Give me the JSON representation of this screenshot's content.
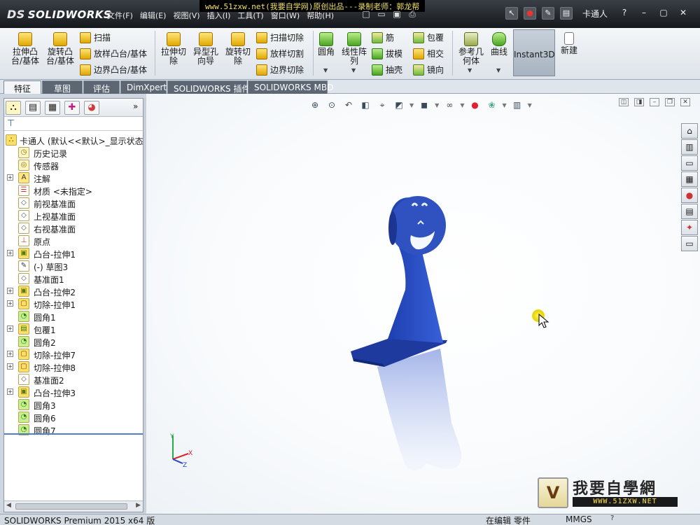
{
  "titlebar": {
    "logo": "SOLIDWORKS",
    "logo_mark": "DS",
    "menus": [
      "文件(F)",
      "编辑(E)",
      "视图(V)",
      "插入(I)",
      "工具(T)",
      "窗口(W)",
      "帮助(H)"
    ],
    "banner": "www.51zxw.net(我要自学网)原创出品---录制老师：郭龙帮",
    "document_title": "卡通人",
    "help": "?"
  },
  "ribbon": {
    "extrude_boss": "拉伸凸\n台/基体",
    "revolve_boss": "旋转凸\n台/基体",
    "sweep": "扫描",
    "loft_boss": "放样凸台/基体",
    "boundary_boss": "边界凸台/基体",
    "extrude_cut": "拉伸切\n除",
    "hole_wizard": "异型孔\n向导",
    "revolve_cut": "旋转切\n除",
    "sweep_cut": "扫描切除",
    "loft_cut": "放样切割",
    "boundary_cut": "边界切除",
    "fillet": "圆角",
    "linear_pattern": "线性阵\n列",
    "rib": "筋",
    "draft": "拔模",
    "shell": "抽壳",
    "wrap": "包覆",
    "intersect": "相交",
    "mirror": "镜向",
    "ref_geometry": "参考几\n何体",
    "curves": "曲线",
    "instant3d": "Instant3D",
    "new": "新建"
  },
  "tabs": [
    {
      "label": "特征",
      "active": true
    },
    {
      "label": "草图",
      "active": false
    },
    {
      "label": "评估",
      "active": false
    },
    {
      "label": "DimXpert",
      "active": false
    },
    {
      "label": "SOLIDWORKS 插件",
      "active": false
    },
    {
      "label": "SOLIDWORKS MBD",
      "active": false
    }
  ],
  "tree": {
    "root": "卡通人 (默认<<默认>_显示状态",
    "items": [
      {
        "label": "历史记录",
        "icon": "history-icon",
        "expandable": false
      },
      {
        "label": "传感器",
        "icon": "sensor-icon",
        "expandable": false
      },
      {
        "label": "注解",
        "icon": "annotation-icon",
        "expandable": true
      },
      {
        "label": "材质 <未指定>",
        "icon": "material-icon",
        "expandable": false
      },
      {
        "label": "前视基准面",
        "icon": "plane-icon",
        "expandable": false
      },
      {
        "label": "上视基准面",
        "icon": "plane-icon",
        "expandable": false
      },
      {
        "label": "右视基准面",
        "icon": "plane-icon",
        "expandable": false
      },
      {
        "label": "原点",
        "icon": "origin-icon",
        "expandable": false
      },
      {
        "label": "凸台-拉伸1",
        "icon": "extrude-boss-icon",
        "expandable": true
      },
      {
        "label": "(-) 草图3",
        "icon": "sketch-icon",
        "expandable": false
      },
      {
        "label": "基准面1",
        "icon": "plane-icon",
        "expandable": false
      },
      {
        "label": "凸台-拉伸2",
        "icon": "extrude-boss-icon",
        "expandable": true
      },
      {
        "label": "切除-拉伸1",
        "icon": "extrude-cut-icon",
        "expandable": true
      },
      {
        "label": "圆角1",
        "icon": "fillet-icon",
        "expandable": false
      },
      {
        "label": "包覆1",
        "icon": "wrap-icon",
        "expandable": true
      },
      {
        "label": "圆角2",
        "icon": "fillet-icon",
        "expandable": false
      },
      {
        "label": "切除-拉伸7",
        "icon": "extrude-cut-icon",
        "expandable": true
      },
      {
        "label": "切除-拉伸8",
        "icon": "extrude-cut-icon",
        "expandable": true
      },
      {
        "label": "基准面2",
        "icon": "plane-icon",
        "expandable": false
      },
      {
        "label": "凸台-拉伸3",
        "icon": "extrude-boss-icon",
        "expandable": true
      },
      {
        "label": "圆角3",
        "icon": "fillet-icon",
        "expandable": false
      },
      {
        "label": "圆角6",
        "icon": "fillet-icon",
        "expandable": false
      },
      {
        "label": "圆角7",
        "icon": "fillet-icon",
        "expandable": false
      }
    ]
  },
  "triad": {
    "x": "X",
    "y": "Y",
    "z": "Z"
  },
  "model": {
    "color": "#2f52c0"
  },
  "statusbar": {
    "product": "SOLIDWORKS Premium 2015 x64 版",
    "mode": "在编辑 零件",
    "units": "MMGS",
    "help_icon": "?"
  },
  "watermark": {
    "title": "我要自學網",
    "url": "WWW.51ZXW.NET",
    "logo_letter": "V"
  }
}
